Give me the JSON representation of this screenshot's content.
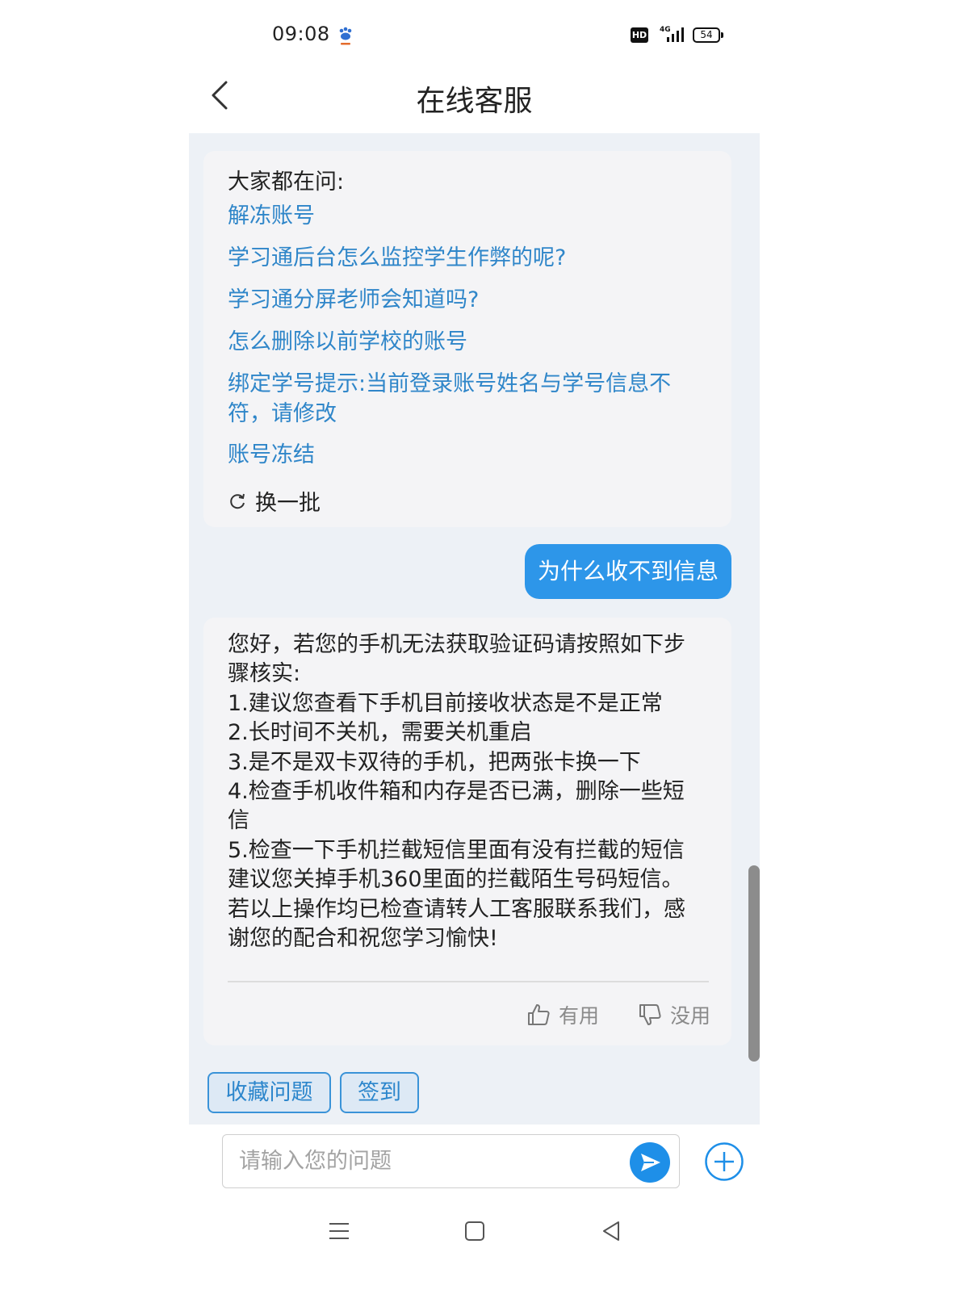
{
  "status_bar": {
    "time": "09:08",
    "hd": "HD",
    "network": "4G",
    "battery": "54"
  },
  "header": {
    "title": "在线客服"
  },
  "faq": {
    "title": "大家都在问:",
    "items": [
      "解冻账号",
      "学习通后台怎么监控学生作弊的呢?",
      "学习通分屏老师会知道吗?",
      "怎么删除以前学校的账号",
      "绑定学号提示:当前登录账号姓名与学号信息不符，请修改",
      "账号冻结"
    ],
    "refresh_label": "换一批"
  },
  "user_message": "为什么收不到信息",
  "answer": {
    "lines": [
      "您好，若您的手机无法获取验证码请按照如下步骤核实:",
      "1.建议您查看下手机目前接收状态是不是正常",
      "2.长时间不关机，需要关机重启",
      "3.是不是双卡双待的手机，把两张卡换一下",
      "4.检查手机收件箱和内存是否已满，删除一些短信",
      "5.检查一下手机拦截短信里面有没有拦截的短信",
      "建议您关掉手机360里面的拦截陌生号码短信。",
      "若以上操作均已检查请转人工客服联系我们，感谢您的配合和祝您学习愉快!"
    ],
    "useful_label": "有用",
    "useless_label": "没用"
  },
  "quick_actions": {
    "collect_label": "收藏问题",
    "checkin_label": "签到"
  },
  "input": {
    "placeholder": "请输入您的问题",
    "value": ""
  },
  "colors": {
    "accent": "#2d96e9",
    "link": "#2f86c9",
    "chat_background": "#edf1f6",
    "card_background": "#f4f4f6"
  }
}
